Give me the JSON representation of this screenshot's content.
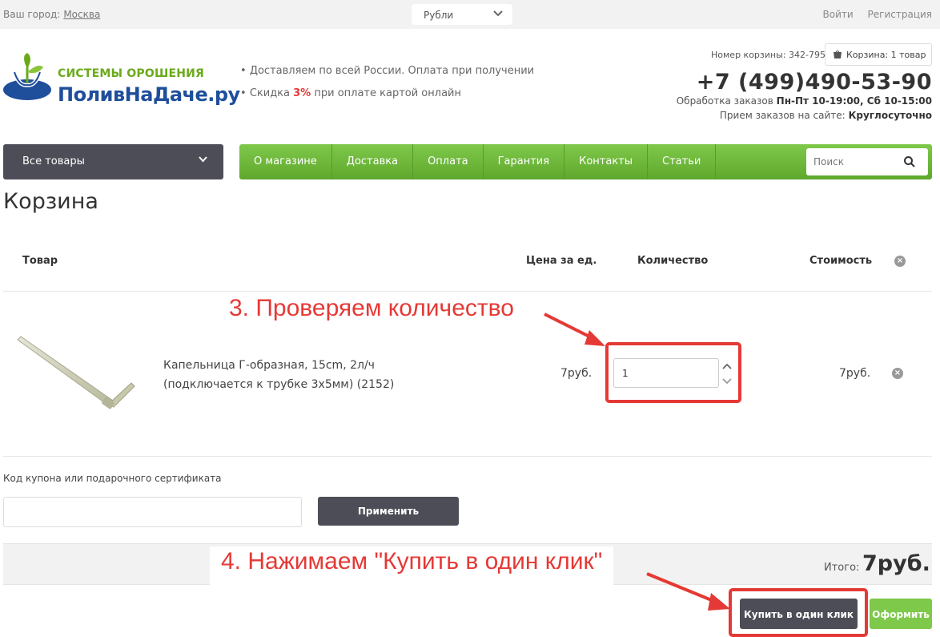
{
  "topbar": {
    "city_label": "Ваш город:",
    "city_name": "Москва",
    "currency": "Рубли",
    "login": "Войти",
    "register": "Регистрация"
  },
  "header": {
    "logo_sub": "СИСТЕМЫ ОРОШЕНИЯ",
    "logo_main": "ПоливНаДаче.ру",
    "promo_1": "Доставляем по всей России. Оплата при получении",
    "promo_2_prefix": "Скидка",
    "promo_2_discount": "3%",
    "promo_2_suffix": "при оплате картой онлайн",
    "basket_number_label": "Номер корзины: 342-795",
    "basket_button": "Корзина: 1 товар",
    "phone": "+7 (499)490-53-90",
    "hours_label": "Обработка заказов",
    "hours_value": "Пн-Пт 10-19:00, Сб 10-15:00",
    "site_orders_label": "Прием заказов на сайте:",
    "site_orders_value": "Круглосуточно"
  },
  "nav": {
    "all_goods": "Все товары",
    "items": [
      "О магазине",
      "Доставка",
      "Оплата",
      "Гарантия",
      "Контакты",
      "Статьи"
    ],
    "search_placeholder": "Поиск"
  },
  "page_title": "Корзина",
  "cart": {
    "columns": {
      "product": "Товар",
      "unit_price": "Цена за ед.",
      "quantity": "Количество",
      "cost": "Стоимость"
    },
    "item": {
      "name_line1": "Капельница Г-образная, 15cm, 2л/ч",
      "name_line2": "(подключается к трубке 3х5мм) (2152)",
      "unit_price": "7руб.",
      "quantity": "1",
      "cost": "7руб."
    }
  },
  "coupon": {
    "label": "Код купона или подарочного сертификата",
    "apply_button": "Применить"
  },
  "total": {
    "label": "Итого:",
    "value": "7руб."
  },
  "actions": {
    "one_click": "Купить в один клик",
    "checkout": "Оформить"
  },
  "annotations": {
    "step3": "3. Проверяем количество",
    "step4": "4. Нажимаем \"Купить в один клик\""
  },
  "colors": {
    "accent_green": "#7ec84a",
    "dark_button": "#4d4d57",
    "annotation_red": "#e53935",
    "logo_blue": "#1f4e9b"
  }
}
